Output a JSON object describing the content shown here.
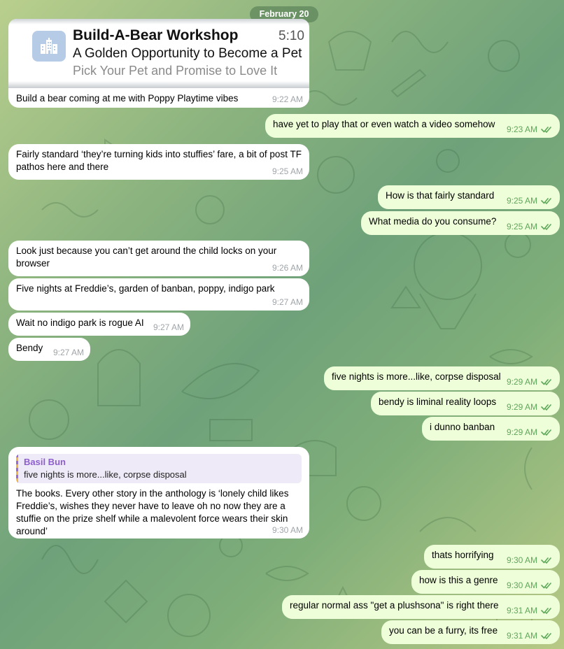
{
  "date_badge": "February 20",
  "link_preview": {
    "icon": "building-icon",
    "title": "Build-A-Bear Workshop",
    "time": "5:10",
    "subtitle": "A Golden Opportunity to Become a Pet",
    "subtitle2": "Pick Your Pet and Promise to Love It"
  },
  "colors": {
    "incoming_bubble": "#ffffff",
    "outgoing_bubble": "#eefed9",
    "read_check": "#5ea85a",
    "quote_accent": "#8d5fcd"
  },
  "messages": [
    {
      "dir": "in",
      "text": "Build a bear coming at me with Poppy Playtime vibes",
      "time": "9:22 AM"
    },
    {
      "dir": "out",
      "text": "have yet to play that or even watch a video somehow",
      "time": "9:23 AM"
    },
    {
      "dir": "in",
      "text": "Fairly standard ‘they’re turning kids into stuffies’ fare, a bit of post TF\npathos here and there",
      "time": "9:25 AM"
    },
    {
      "dir": "out",
      "text": "How is that fairly standard",
      "time": "9:25 AM"
    },
    {
      "dir": "out",
      "text": "What media do you consume?",
      "time": "9:25 AM"
    },
    {
      "dir": "in",
      "text": "Look just because you can’t get around the child locks on your\nbrowser",
      "time": "9:26 AM"
    },
    {
      "dir": "in",
      "text": "Five nights at Freddie’s, garden of banban, poppy, indigo park",
      "time": "9:27 AM"
    },
    {
      "dir": "in",
      "text": "Wait no indigo park is rogue AI",
      "time": "9:27 AM"
    },
    {
      "dir": "in",
      "text": "Bendy",
      "time": "9:27 AM"
    },
    {
      "dir": "out",
      "text": "five nights is more...like, corpse disposal",
      "time": "9:29 AM"
    },
    {
      "dir": "out",
      "text": "bendy is liminal reality loops",
      "time": "9:29 AM"
    },
    {
      "dir": "out",
      "text": "i dunno banban",
      "time": "9:29 AM"
    },
    {
      "dir": "in",
      "reply": {
        "name": "Basil Bun",
        "text": "five nights is more...like, corpse disposal"
      },
      "text": "The books. Every other story in the anthology is ‘lonely child likes\nFreddie’s, wishes they never have to leave oh no now they are a\nstuffie on the prize shelf while a malevolent force wears their skin\naround’",
      "time": "9:30 AM"
    },
    {
      "dir": "out",
      "text": "thats horrifying",
      "time": "9:30 AM"
    },
    {
      "dir": "out",
      "text": "how is this a genre",
      "time": "9:30 AM"
    },
    {
      "dir": "out",
      "text": "regular normal ass \"get a plushsona\" is right there",
      "time": "9:31 AM"
    },
    {
      "dir": "out",
      "text": "you can be a furry, its free",
      "time": "9:31 AM"
    }
  ]
}
